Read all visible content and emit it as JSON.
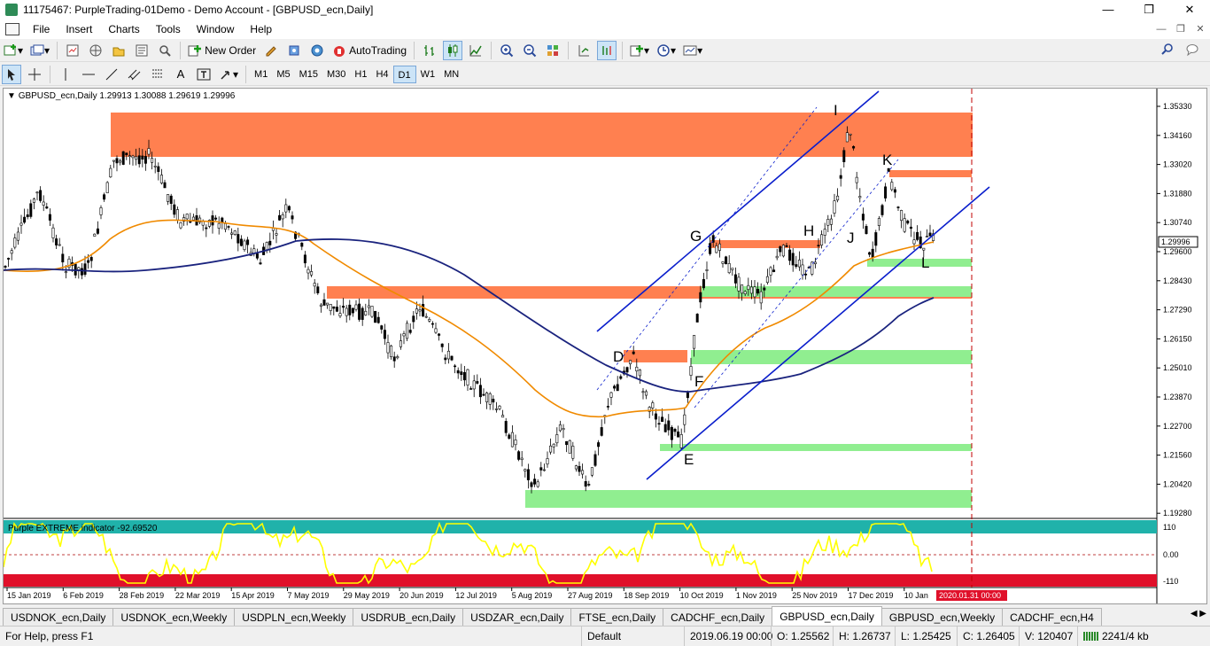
{
  "window": {
    "title": "11175467: PurpleTrading-01Demo - Demo Account - [GBPUSD_ecn,Daily]"
  },
  "menu": [
    "File",
    "Insert",
    "Charts",
    "Tools",
    "Window",
    "Help"
  ],
  "toolbar": {
    "new_order": "New Order",
    "autotrading": "AutoTrading"
  },
  "timeframes": [
    "M1",
    "M5",
    "M15",
    "M30",
    "H1",
    "H4",
    "D1",
    "W1",
    "MN"
  ],
  "active_timeframe": "D1",
  "chart": {
    "header": "GBPUSD_ecn,Daily  1.29913 1.30088 1.29619 1.29996",
    "current_price": "1.29996",
    "price_ticks": [
      "1.35330",
      "1.34160",
      "1.33020",
      "1.31880",
      "1.30740",
      "1.29600",
      "1.28430",
      "1.27290",
      "1.26150",
      "1.25010",
      "1.23870",
      "1.22700",
      "1.21560",
      "1.20420",
      "1.19280"
    ],
    "date_ticks": [
      "15 Jan 2019",
      "6 Feb 2019",
      "28 Feb 2019",
      "22 Mar 2019",
      "15 Apr 2019",
      "7 May 2019",
      "29 May 2019",
      "20 Jun 2019",
      "12 Jul 2019",
      "5 Aug 2019",
      "27 Aug 2019",
      "18 Sep 2019",
      "10 Oct 2019",
      "1 Nov 2019",
      "25 Nov 2019",
      "17 Dec 2019",
      "10 Jan"
    ],
    "future_date": "2020.01.31 00:00",
    "points": [
      "D",
      "E",
      "F",
      "G",
      "H",
      "I",
      "J",
      "K",
      "L"
    ],
    "zone_colors": {
      "supply": "#ff8050",
      "demand": "#90ee90"
    },
    "indicator": {
      "label": "Purple EXTREME indicator -92.69520",
      "ticks": [
        "110",
        "0.00",
        "-110"
      ],
      "colors": {
        "upper_band": "#20b2aa",
        "lower_band": "#e0102a",
        "line": "#ffff00"
      }
    }
  },
  "tabs": [
    "USDNOK_ecn,Daily",
    "USDNOK_ecn,Weekly",
    "USDPLN_ecn,Weekly",
    "USDRUB_ecn,Daily",
    "USDZAR_ecn,Daily",
    "FTSE_ecn,Daily",
    "CADCHF_ecn,Daily",
    "GBPUSD_ecn,Daily",
    "GBPUSD_ecn,Weekly",
    "CADCHF_ecn,H4"
  ],
  "active_tab": "GBPUSD_ecn,Daily",
  "status": {
    "help": "For Help, press F1",
    "profile": "Default",
    "datetime": "2019.06.19 00:00",
    "open": "O: 1.25562",
    "high": "H: 1.26737",
    "low": "L: 1.25425",
    "close": "C: 1.26405",
    "volume": "V: 120407",
    "traffic": "2241/4 kb"
  }
}
